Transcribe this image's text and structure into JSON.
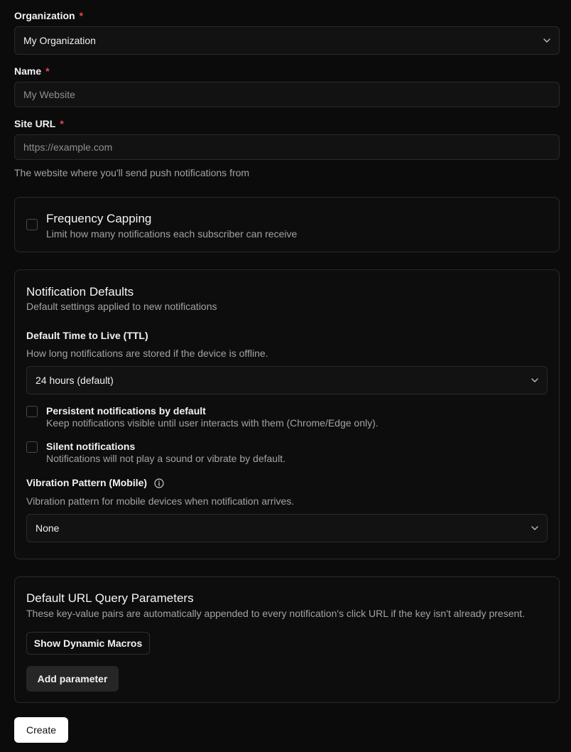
{
  "form": {
    "organization": {
      "label": "Organization",
      "required_mark": "*",
      "value": "My Organization",
      "icon": "chevron-down-icon"
    },
    "name": {
      "label": "Name",
      "required_mark": "*",
      "placeholder": "My Website"
    },
    "site_url": {
      "label": "Site URL",
      "required_mark": "*",
      "placeholder": "https://example.com",
      "hint": "The website where you'll send push notifications from"
    }
  },
  "frequency_capping": {
    "checked": false,
    "title": "Frequency Capping",
    "description": "Limit how many notifications each subscriber can receive"
  },
  "notification_defaults": {
    "title": "Notification Defaults",
    "description": "Default settings applied to new notifications",
    "ttl": {
      "label": "Default Time to Live (TTL)",
      "hint": "How long notifications are stored if the device is offline.",
      "value": "24 hours (default)"
    },
    "persistent": {
      "checked": false,
      "label": "Persistent notifications by default",
      "hint": "Keep notifications visible until user interacts with them (Chrome/Edge only)."
    },
    "silent": {
      "checked": false,
      "label": "Silent notifications",
      "hint": "Notifications will not play a sound or vibrate by default."
    },
    "vibration": {
      "label": "Vibration Pattern (Mobile)",
      "icon": "info-icon",
      "hint": "Vibration pattern for mobile devices when notification arrives.",
      "value": "None"
    }
  },
  "query_params": {
    "title": "Default URL Query Parameters",
    "description": "These key-value pairs are automatically appended to every notification's click URL if the key isn't already present.",
    "show_macros_label": "Show Dynamic Macros",
    "add_parameter_label": "Add parameter"
  },
  "actions": {
    "create_label": "Create"
  },
  "colors": {
    "background": "#0b0b0b",
    "required": "#e5484d",
    "primary_button": "#ffffff"
  }
}
